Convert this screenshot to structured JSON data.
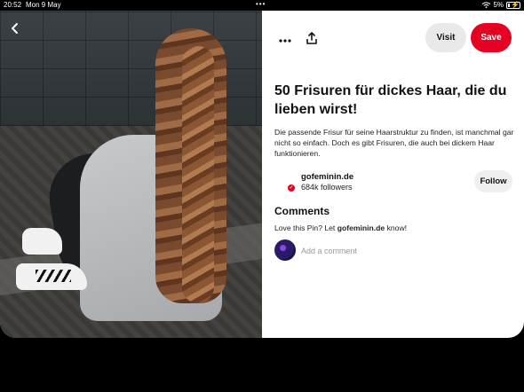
{
  "status_bar": {
    "time": "20:52",
    "date": "Mon 9 May",
    "battery_label": "5%"
  },
  "toolbar": {
    "more_icon": "ellipsis-icon",
    "share_icon": "share-icon",
    "visit_label": "Visit",
    "save_label": "Save",
    "save_color": "#e60023"
  },
  "pin": {
    "title": "50 Frisuren für dickes Haar, die du lieben wirst!",
    "description": "Die passende Frisur für seine Haarstruktur zu finden, ist manchmal gar nicht so einfach. Doch es gibt Frisuren, die auch bei dickem Haar funktionieren."
  },
  "source": {
    "name": "gofeminin.de",
    "followers": "684k followers",
    "follow_label": "Follow"
  },
  "comments": {
    "heading": "Comments",
    "prompt_prefix": "Love this Pin? Let ",
    "prompt_name": "gofeminin.de",
    "prompt_suffix": " know!",
    "placeholder": "Add a comment"
  }
}
